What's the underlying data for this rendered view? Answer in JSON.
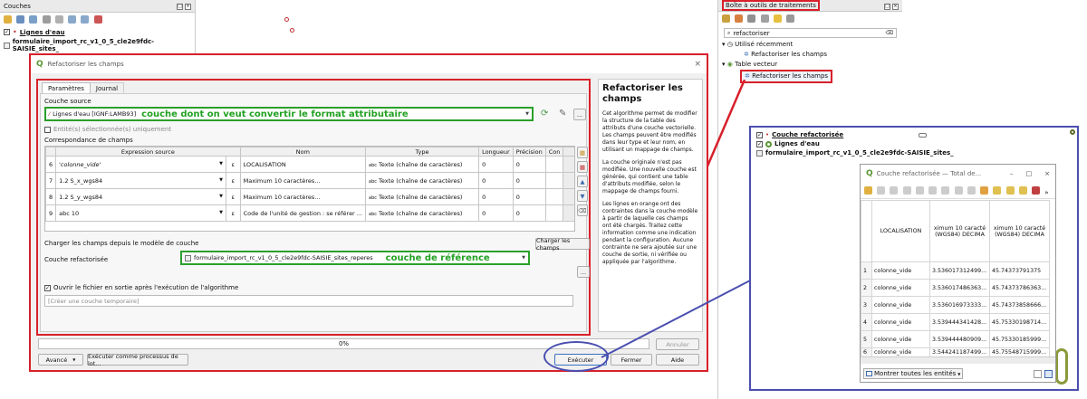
{
  "colors": {
    "red": "#d8202a",
    "green": "#2aa02a",
    "blue": "#4a4fb0",
    "qgis_green": "#589632"
  },
  "layers_panel": {
    "title": "Couches",
    "items": [
      {
        "label": "Lignes d'eau",
        "checked": true
      },
      {
        "label": "formulaire_import_rc_v1_0_5_cle2e9fdc-SAISIE_sites_"
      }
    ]
  },
  "toolbox": {
    "title": "Boîte à outils de traitements",
    "search_value": "refactoriser",
    "tree": [
      {
        "label": "Utilisé récemment"
      },
      {
        "label": "Refactoriser les champs"
      },
      {
        "label": "Table vecteur"
      },
      {
        "label": "Refactoriser les champs"
      }
    ]
  },
  "dialog": {
    "title": "Refactoriser les champs",
    "tabs": [
      "Paramètres",
      "Journal"
    ],
    "source_label": "Couche source",
    "source_value": "Lignes d'eau [IGNF:LAMB93]",
    "selected_only": "Entité(s) sélectionnée(s) uniquement",
    "mapping_label": "Correspondance de champs",
    "columns": [
      "Expression source",
      "Nom",
      "Type",
      "Longueur",
      "Précision",
      "Con"
    ],
    "rows": [
      {
        "num": "6",
        "expr": "'colonne_vide'",
        "name": "LOCALISATION",
        "type": "Texte (chaîne de caractères)",
        "len": "0",
        "prec": "0"
      },
      {
        "num": "7",
        "expr": "1.2 S_x_wgs84",
        "name": "Maximum 10 caractères...",
        "type": "Texte (chaîne de caractères)",
        "len": "0",
        "prec": "0"
      },
      {
        "num": "8",
        "expr": "1.2 S_y_wgs84",
        "name": "Maximum 10 caractères...",
        "type": "Texte (chaîne de caractères)",
        "len": "0",
        "prec": "0"
      },
      {
        "num": "9",
        "expr": "abc 10",
        "name": "Code de l'unité de gestion : se référer ...",
        "type": "Texte (chaîne de caractères)",
        "len": "0",
        "prec": "0"
      }
    ],
    "type_prefix": "abc",
    "load_label": "Charger les champs depuis le modèle de couche",
    "load_value": "formulaire_import_rc_v1_0_5_cle2e9fdc-SAISIE_sites_reperes",
    "load_button": "Charger les champs",
    "output_label": "Couche refactorisée",
    "output_placeholder": "[Créer une couche temporaire]",
    "open_after": "Ouvrir le fichier en sortie après l'exécution de l'algorithme",
    "progress": "0%",
    "progress_fraction": 0,
    "btn_cancel": "Annuler",
    "btn_advanced": "Avancé",
    "btn_batch": "Exécuter comme processus de lot...",
    "btn_run": "Exécuter",
    "btn_close": "Fermer",
    "btn_help": "Aide",
    "help_title": "Refactoriser les champs",
    "help_p1": "Cet algorithme permet de modifier la structure de la table des attributs d'une couche vectorielle. Les champs peuvent être modifiés dans leur type et leur nom, en utilisant un mappage de champs.",
    "help_p2": "La couche originale n'est pas modifiée. Une nouvelle couche est générée, qui contient une table d'attributs modifiée, selon le mappage de champs fourni.",
    "help_p3": "Les lignes en orange ont des contraintes dans la couche modèle à partir de laquelle ces champs ont été chargés. Traitez cette information comme une indication pendant la configuration. Aucune contrainte ne sera ajoutée sur une couche de sortie, ni vérifiée ou appliquée par l'algorithme."
  },
  "annotations": {
    "source_note": "couche dont on veut convertir le format attributaire",
    "ref_note": "couche de référence"
  },
  "inset": {
    "layers": [
      {
        "label": "Couche refactorisée"
      },
      {
        "label": "Lignes d'eau"
      },
      {
        "label": "formulaire_import_rc_v1_0_5_cle2e9fdc-SAISIE_sites_"
      }
    ],
    "table_title": "Couche refactorisée — Total de...",
    "columns": [
      "LOCALISATION",
      "ximum 10 caracté (WGS84) DECIMA",
      "ximum 10 caracté (WGS84) DECIMA"
    ],
    "rows": [
      {
        "n": "1",
        "a": "colonne_vide",
        "b": "3.536017312499...",
        "c": "45.74373791375"
      },
      {
        "n": "2",
        "a": "colonne_vide",
        "b": "3.536017486363...",
        "c": "45.74373786363..."
      },
      {
        "n": "3",
        "a": "colonne_vide",
        "b": "3.536016973333...",
        "c": "45.74373858666..."
      },
      {
        "n": "4",
        "a": "colonne_vide",
        "b": "3.539444341428...",
        "c": "45.75330198714..."
      },
      {
        "n": "5",
        "a": "colonne_vide",
        "b": "3.539444480909...",
        "c": "45.75330185999..."
      },
      {
        "n": "6",
        "a": "colonne_vide",
        "b": "3.544241187499...",
        "c": "45.75548715999..."
      }
    ],
    "show_all": "Montrer toutes les entités"
  }
}
